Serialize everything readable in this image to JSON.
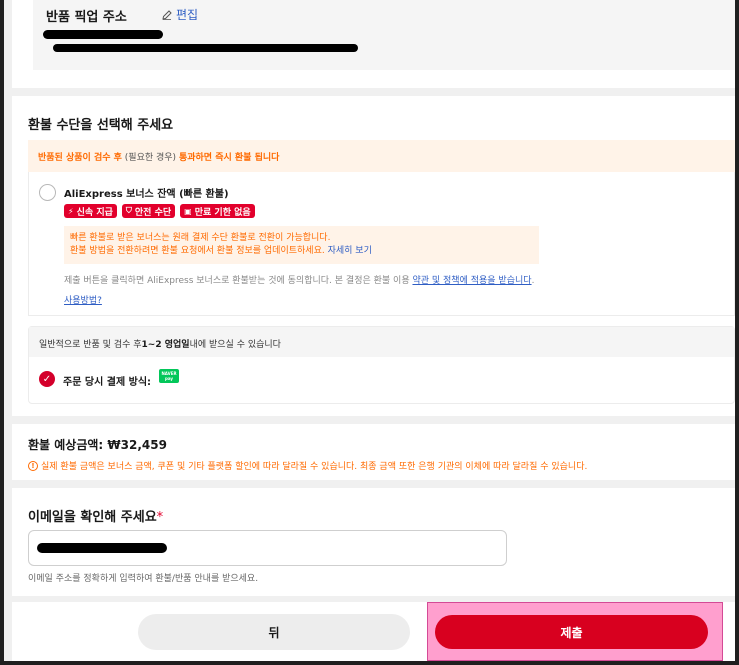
{
  "address": {
    "title": "반품 픽업 주소",
    "edit_label": "편집"
  },
  "method": {
    "title": "환불 수단을 선택해 주세요",
    "notice_highlight_1": "반품된 상품이 검수 후",
    "notice_mid": " (필요한 경우) ",
    "notice_highlight_2": "통과하면 즉시 환불 됩니다",
    "option_title": "AliExpress 보너스 잔액 (빠른 환불)",
    "badges": [
      "신속 지급",
      "안전 수단",
      "만료 기한 없음"
    ],
    "info_line1": "빠른 환불로 받은 보너스는 원래 결제 수단 환불로 전환이 가능합니다.",
    "info_line2": "환불 방법을 전환하려면 환불 요청에서 환불 정보를 업데이트하세요.",
    "info_link": "자세히 보기",
    "agree_text": "제출 버튼을 클릭하면 AliExpress 보너스로 환불받는 것에 동의합니다. 본 결정은 환불 이용 ",
    "agree_link": "약관 및 정책에 적용을 받습니다",
    "agree_end": ".",
    "howto_link": "사용방법?",
    "pay_head_pre": "일반적으로 반품 및 검수 후",
    "pay_head_bold": "1~2 영업일",
    "pay_head_post": "내에 받으실 수 있습니다",
    "pay_label": "주문 당시 결제 방식:",
    "npay_line1": "NAVER",
    "npay_line2": "pay"
  },
  "estimate": {
    "title": "환불 예상금액: ₩32,459",
    "note": "실제 환불 금액은 보너스 금액, 쿠폰 및 기타 플랫폼 할인에 따라 달라질 수 있습니다. 최종 금액 또한 은행 기관의 이체에 따라 달라질 수 있습니다."
  },
  "email": {
    "title": "이메일을 확인해 주세요",
    "required_mark": "*",
    "help": "이메일 주소를 정확하게 입력하여 환불/반품 안내를 받으세요."
  },
  "footer": {
    "back_label": "뒤",
    "submit_label": "제출"
  },
  "colors": {
    "accent_red": "#d8001f",
    "notice_orange": "#ff6a00",
    "link_blue": "#2f5ec4",
    "naver_green": "#03c75a"
  }
}
